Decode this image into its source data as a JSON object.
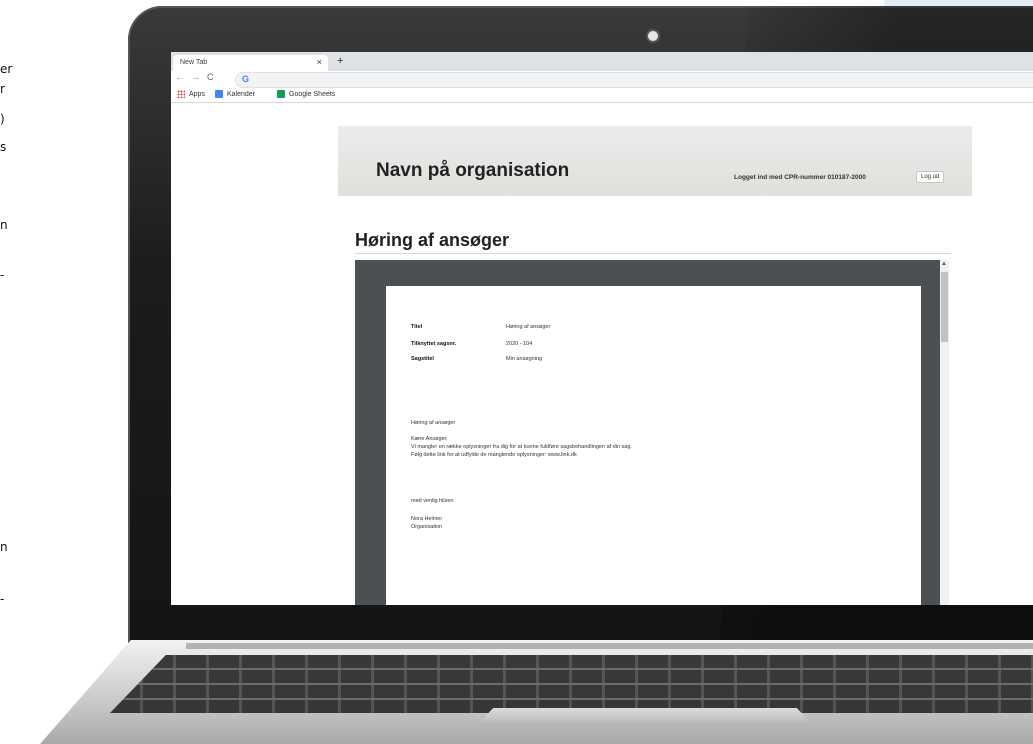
{
  "left_fragments": [
    "er",
    "r",
    ")",
    "s",
    "n",
    "-",
    "n",
    "-"
  ],
  "browser": {
    "tab_title": "New Tab",
    "tab_close": "×",
    "new_tab": "+",
    "nav_back": "←",
    "nav_forward": "→",
    "nav_reload": "C",
    "omnibox_icon": "G",
    "bookmarks": [
      {
        "label": "Apps",
        "icon": "apps-grid-icon"
      },
      {
        "label": "Kalender",
        "icon": "calendar-icon"
      },
      {
        "label": "Google Sheets",
        "icon": "sheets-icon"
      }
    ]
  },
  "page": {
    "org_name": "Navn på organisation",
    "logged_in_text": "Logget ind med CPR-nummer 010187-2000",
    "logout_label": "Log ud",
    "heading": "Høring af ansøger"
  },
  "document": {
    "meta": [
      {
        "label": "Titel",
        "value": "Høring af ansøger"
      },
      {
        "label": "Tilknyttet sagsnr.",
        "value": "2020 - 104"
      },
      {
        "label": "Sagstitel",
        "value": "Min ansøgning"
      }
    ],
    "subject": "Høring af ansøger",
    "greeting": "Kære Ansøger,",
    "line1": "Vi mangler en række oplysninger fra dig for at kunne fuldføre sagsbehandlingen af din sag.",
    "line2": "Følg dette link for at udfylde de manglende oplysninger: www.link.dk",
    "closing": "med venlig hilsen",
    "sender_name": "Nora Helmer",
    "sender_org": "Organisation"
  },
  "colors": {
    "side_panel": "#e4edf6",
    "viewer_bg": "#4d5052",
    "header_bg": "#e6e5e1"
  }
}
